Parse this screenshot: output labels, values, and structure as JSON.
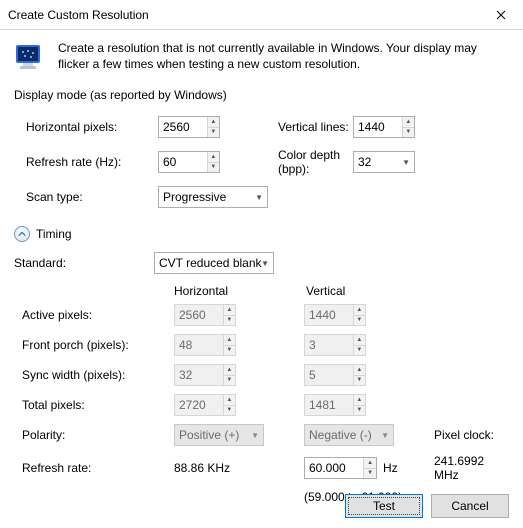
{
  "window": {
    "title": "Create Custom Resolution"
  },
  "intro": "Create a resolution that is not currently available in Windows. Your display may flicker a few times when testing a new custom resolution.",
  "display_mode": {
    "group_label": "Display mode (as reported by Windows)",
    "hpix_label": "Horizontal pixels:",
    "hpix_value": "2560",
    "vlines_label": "Vertical lines:",
    "vlines_value": "1440",
    "refresh_label": "Refresh rate (Hz):",
    "refresh_value": "60",
    "depth_label": "Color depth (bpp):",
    "depth_value": "32",
    "scan_label": "Scan type:",
    "scan_value": "Progressive"
  },
  "timing": {
    "header": "Timing",
    "standard_label": "Standard:",
    "standard_value": "CVT reduced blank",
    "col_h": "Horizontal",
    "col_v": "Vertical",
    "active_label": "Active pixels:",
    "active_h": "2560",
    "active_v": "1440",
    "fp_label": "Front porch (pixels):",
    "fp_h": "48",
    "fp_v": "3",
    "sw_label": "Sync width (pixels):",
    "sw_h": "32",
    "sw_v": "5",
    "tp_label": "Total pixels:",
    "tp_h": "2720",
    "tp_v": "1481",
    "polarity_label": "Polarity:",
    "polarity_h": "Positive (+)",
    "polarity_v": "Negative (-)",
    "refresh_label": "Refresh rate:",
    "refresh_h": "88.86 KHz",
    "refresh_v": "60.000",
    "hz_suffix": "Hz",
    "refresh_range": "(59.000 to 61.000)",
    "pixel_clock_label": "Pixel clock:",
    "pixel_clock_value": "241.6992 MHz"
  },
  "buttons": {
    "test": "Test",
    "cancel": "Cancel"
  }
}
